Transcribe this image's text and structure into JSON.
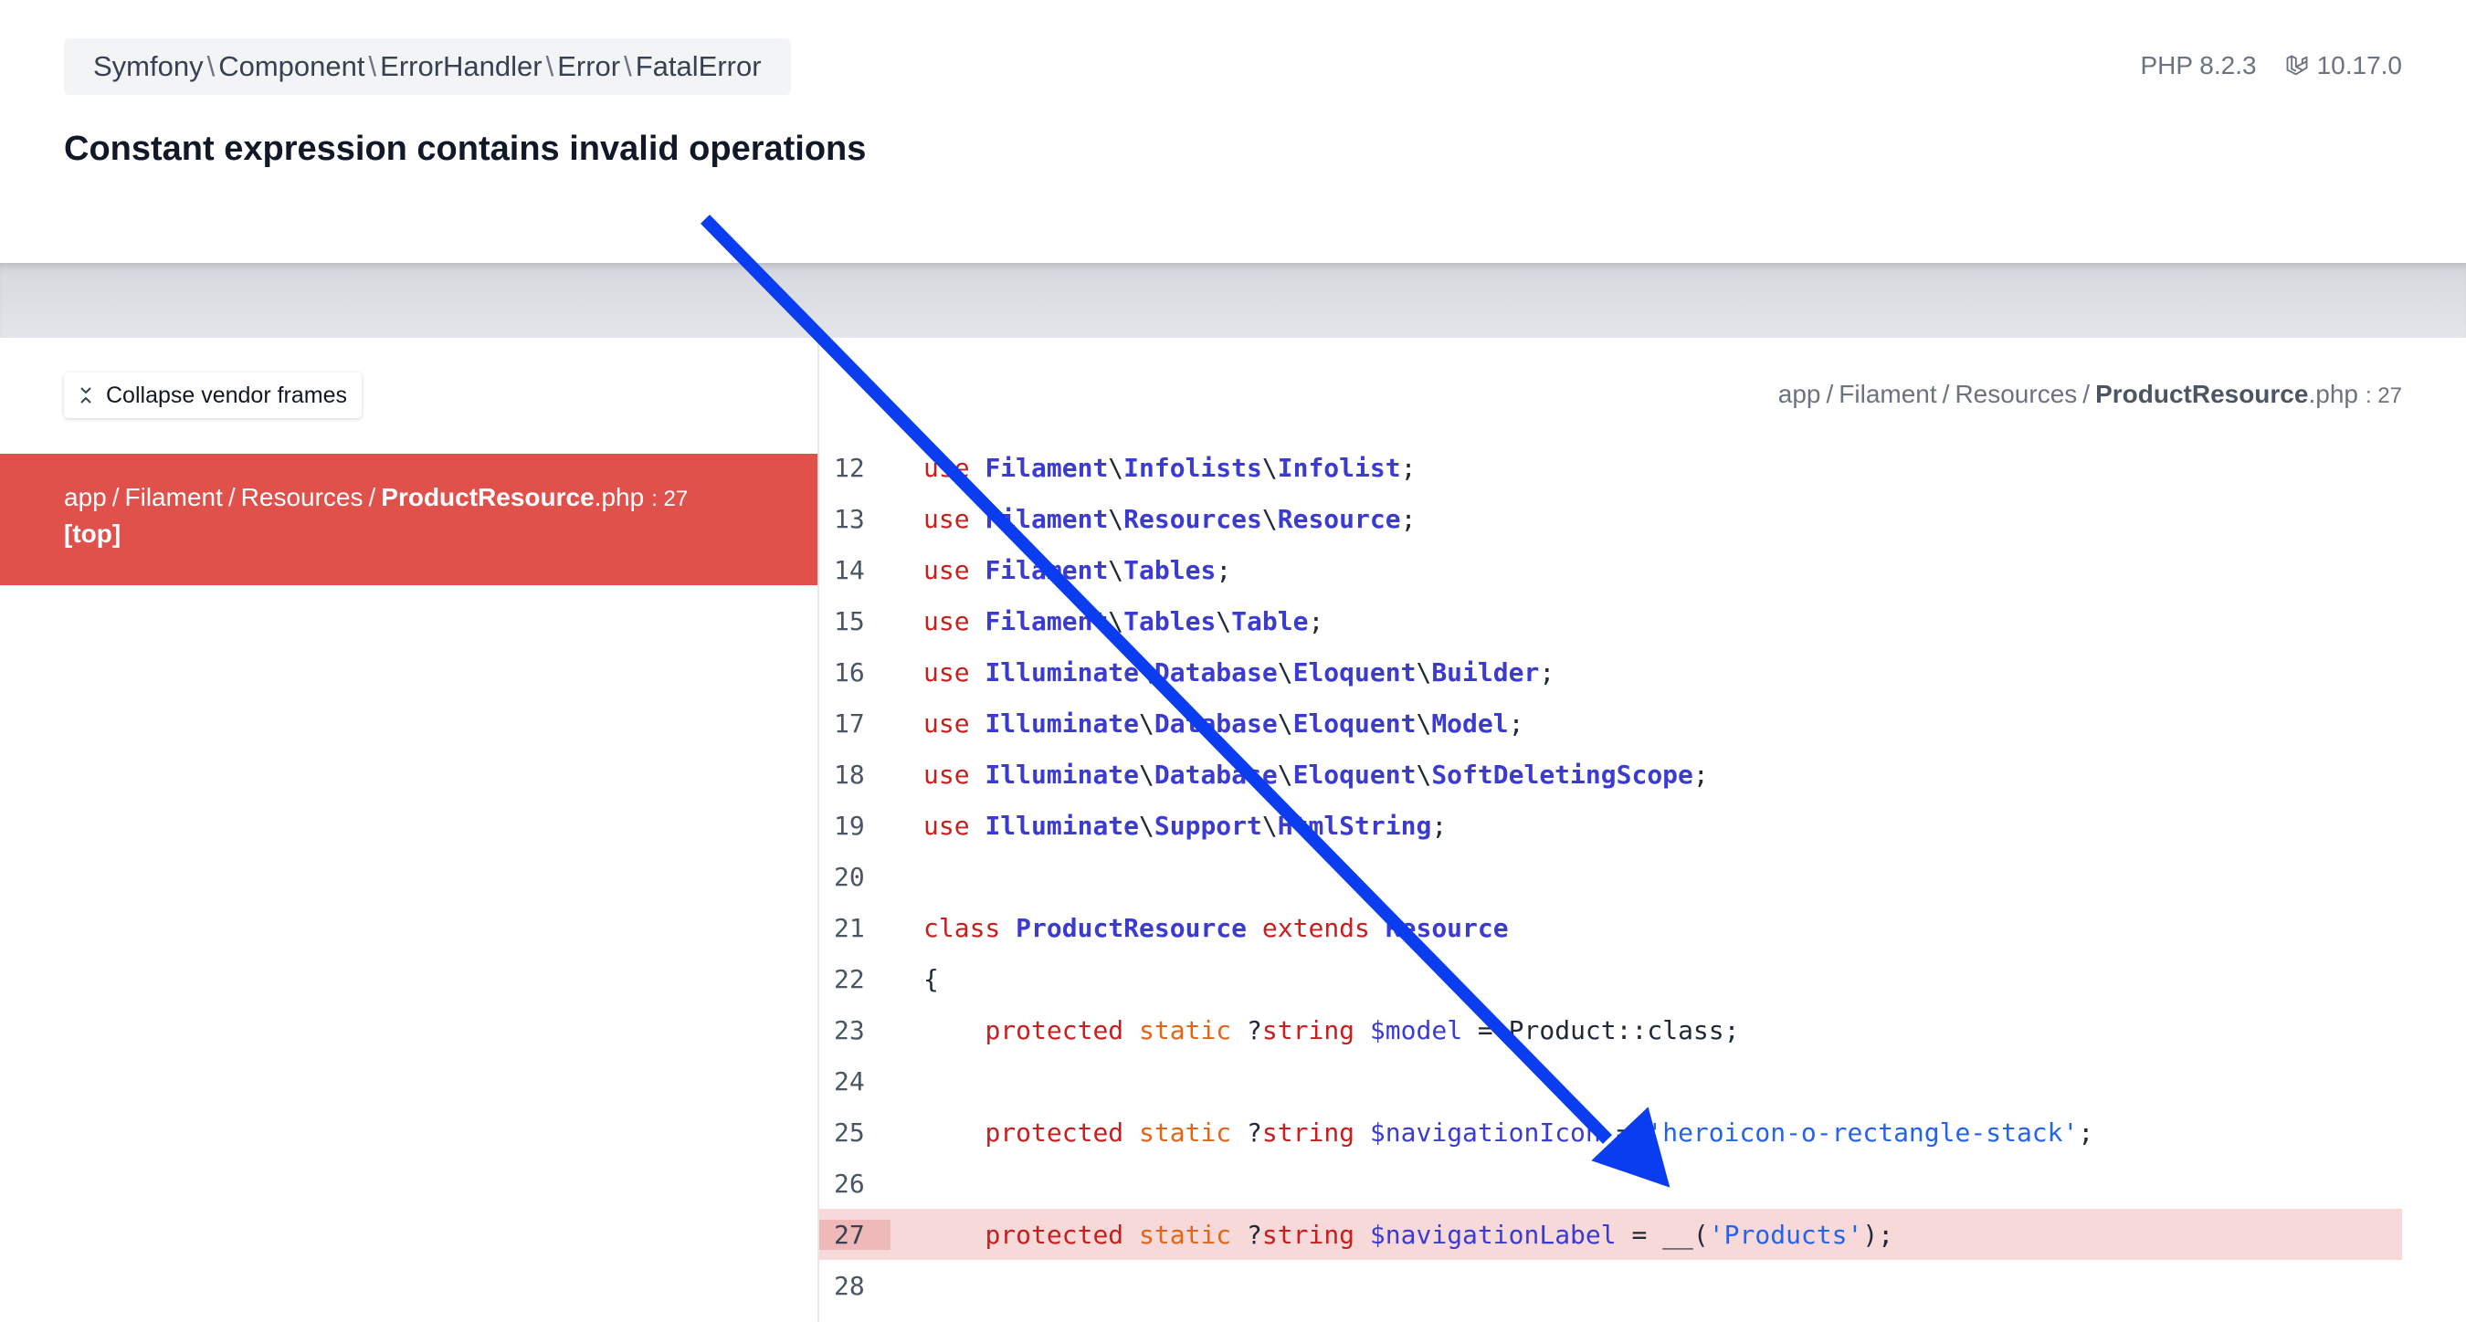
{
  "exception": {
    "parts": [
      "Symfony",
      "Component",
      "ErrorHandler",
      "Error",
      "FatalError"
    ],
    "separator": "\\",
    "message": "Constant expression contains invalid operations"
  },
  "versions": {
    "php": "PHP 8.2.3",
    "laravel": "10.17.0",
    "laravel_icon": "laravel-logo-icon"
  },
  "sidebar": {
    "collapse_label": "Collapse vendor frames",
    "collapse_icon": "collapse-chevrons-icon",
    "active_frame": {
      "path_parts": [
        "app",
        "Filament",
        "Resources"
      ],
      "file": "ProductResource",
      "ext": ".php",
      "line": ": 27",
      "label": "[top]"
    }
  },
  "code_header": {
    "path_parts": [
      "app",
      "Filament",
      "Resources"
    ],
    "file": "ProductResource",
    "ext": ".php",
    "line": ": 27"
  },
  "code": {
    "highlighted_line": 27,
    "lines": [
      {
        "n": "12",
        "tokens": [
          [
            "kw",
            "use "
          ],
          [
            "ns",
            "Filament"
          ],
          [
            "p",
            "\\"
          ],
          [
            "ns",
            "Infolists"
          ],
          [
            "p",
            "\\"
          ],
          [
            "ns",
            "Infolist"
          ],
          [
            "p",
            ";"
          ]
        ]
      },
      {
        "n": "13",
        "tokens": [
          [
            "kw",
            "use "
          ],
          [
            "ns",
            "Filament"
          ],
          [
            "p",
            "\\"
          ],
          [
            "ns",
            "Resources"
          ],
          [
            "p",
            "\\"
          ],
          [
            "ns",
            "Resource"
          ],
          [
            "p",
            ";"
          ]
        ]
      },
      {
        "n": "14",
        "tokens": [
          [
            "kw",
            "use "
          ],
          [
            "ns",
            "Filament"
          ],
          [
            "p",
            "\\"
          ],
          [
            "ns",
            "Tables"
          ],
          [
            "p",
            ";"
          ]
        ]
      },
      {
        "n": "15",
        "tokens": [
          [
            "kw",
            "use "
          ],
          [
            "ns",
            "Filament"
          ],
          [
            "p",
            "\\"
          ],
          [
            "ns",
            "Tables"
          ],
          [
            "p",
            "\\"
          ],
          [
            "ns",
            "Table"
          ],
          [
            "p",
            ";"
          ]
        ]
      },
      {
        "n": "16",
        "tokens": [
          [
            "kw",
            "use "
          ],
          [
            "ns",
            "Illuminate"
          ],
          [
            "p",
            "\\"
          ],
          [
            "ns",
            "Database"
          ],
          [
            "p",
            "\\"
          ],
          [
            "ns",
            "Eloquent"
          ],
          [
            "p",
            "\\"
          ],
          [
            "ns",
            "Builder"
          ],
          [
            "p",
            ";"
          ]
        ]
      },
      {
        "n": "17",
        "tokens": [
          [
            "kw",
            "use "
          ],
          [
            "ns",
            "Illuminate"
          ],
          [
            "p",
            "\\"
          ],
          [
            "ns",
            "Database"
          ],
          [
            "p",
            "\\"
          ],
          [
            "ns",
            "Eloquent"
          ],
          [
            "p",
            "\\"
          ],
          [
            "ns",
            "Model"
          ],
          [
            "p",
            ";"
          ]
        ]
      },
      {
        "n": "18",
        "tokens": [
          [
            "kw",
            "use "
          ],
          [
            "ns",
            "Illuminate"
          ],
          [
            "p",
            "\\"
          ],
          [
            "ns",
            "Database"
          ],
          [
            "p",
            "\\"
          ],
          [
            "ns",
            "Eloquent"
          ],
          [
            "p",
            "\\"
          ],
          [
            "ns",
            "SoftDeletingScope"
          ],
          [
            "p",
            ";"
          ]
        ]
      },
      {
        "n": "19",
        "tokens": [
          [
            "kw",
            "use "
          ],
          [
            "ns",
            "Illuminate"
          ],
          [
            "p",
            "\\"
          ],
          [
            "ns",
            "Support"
          ],
          [
            "p",
            "\\"
          ],
          [
            "ns",
            "HtmlString"
          ],
          [
            "p",
            ";"
          ]
        ]
      },
      {
        "n": "20",
        "tokens": []
      },
      {
        "n": "21",
        "tokens": [
          [
            "kw",
            "class "
          ],
          [
            "ns",
            "ProductResource"
          ],
          [
            "kw",
            " extends "
          ],
          [
            "ns",
            "Resource"
          ]
        ]
      },
      {
        "n": "22",
        "tokens": [
          [
            "p",
            "{"
          ]
        ]
      },
      {
        "n": "23",
        "tokens": [
          [
            "p",
            "    "
          ],
          [
            "kw",
            "protected "
          ],
          [
            "kw2",
            "static "
          ],
          [
            "p",
            "?"
          ],
          [
            "kw",
            "string "
          ],
          [
            "var",
            "$model"
          ],
          [
            "p",
            " = Product::class;"
          ]
        ]
      },
      {
        "n": "24",
        "tokens": []
      },
      {
        "n": "25",
        "tokens": [
          [
            "p",
            "    "
          ],
          [
            "kw",
            "protected "
          ],
          [
            "kw2",
            "static "
          ],
          [
            "p",
            "?"
          ],
          [
            "kw",
            "string "
          ],
          [
            "var",
            "$navigationIcon"
          ],
          [
            "p",
            " = "
          ],
          [
            "str",
            "'heroicon-o-rectangle-stack'"
          ],
          [
            "p",
            ";"
          ]
        ]
      },
      {
        "n": "26",
        "tokens": []
      },
      {
        "n": "27",
        "tokens": [
          [
            "p",
            "    "
          ],
          [
            "kw",
            "protected "
          ],
          [
            "kw2",
            "static "
          ],
          [
            "p",
            "?"
          ],
          [
            "kw",
            "string "
          ],
          [
            "var",
            "$navigationLabel"
          ],
          [
            "p",
            " = __("
          ],
          [
            "str",
            "'Products'"
          ],
          [
            "p",
            ");"
          ]
        ]
      },
      {
        "n": "28",
        "tokens": []
      }
    ]
  },
  "colors": {
    "accent_red": "#e0514c",
    "highlight_row": "#f7d9d9",
    "annotation_arrow": "#0a3cf0"
  }
}
